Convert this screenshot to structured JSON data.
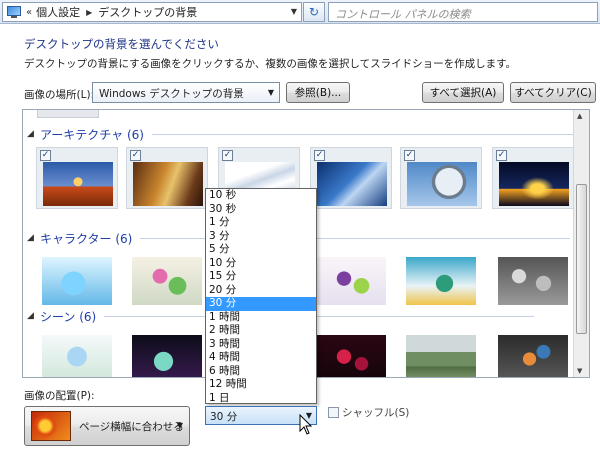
{
  "address": {
    "chevrons": "«",
    "crumbs": [
      "個人設定",
      "デスクトップの背景"
    ],
    "refresh_icon": "refresh-icon"
  },
  "search": {
    "placeholder": "コントロール パネルの検索"
  },
  "header": {
    "title": "デスクトップの背景を選んでください",
    "description": "デスクトップの背景にする画像をクリックするか、複数の画像を選択してスライドショーを作成します。"
  },
  "location": {
    "label": "画像の場所(L):",
    "value": "Windows デスクトップの背景",
    "browse": "参照(B)...",
    "select_all": "すべて選択(A)",
    "clear_all": "すべてクリア(C)"
  },
  "groups": [
    {
      "label": "アーキテクチャ (6)",
      "checked": true
    },
    {
      "label": "キャラクター (6)",
      "checked": false
    },
    {
      "label": "シーン (6)",
      "checked": false
    }
  ],
  "position": {
    "label": "画像の配置(P):",
    "value": "ページ横幅に合わせる"
  },
  "interval": {
    "value": "30 分",
    "options": [
      "10 秒",
      "30 秒",
      "1 分",
      "3 分",
      "5 分",
      "10 分",
      "15 分",
      "20 分",
      "30 分",
      "1 時間",
      "2 時間",
      "3 時間",
      "4 時間",
      "6 時間",
      "12 時間",
      "1 日"
    ],
    "selected_index": 8
  },
  "shuffle": {
    "label": "シャッフル(S)",
    "checked": false
  },
  "colors": {
    "title": "#1e3287",
    "group_header": "#1e3ea8",
    "list_highlight": "#3399ff"
  }
}
